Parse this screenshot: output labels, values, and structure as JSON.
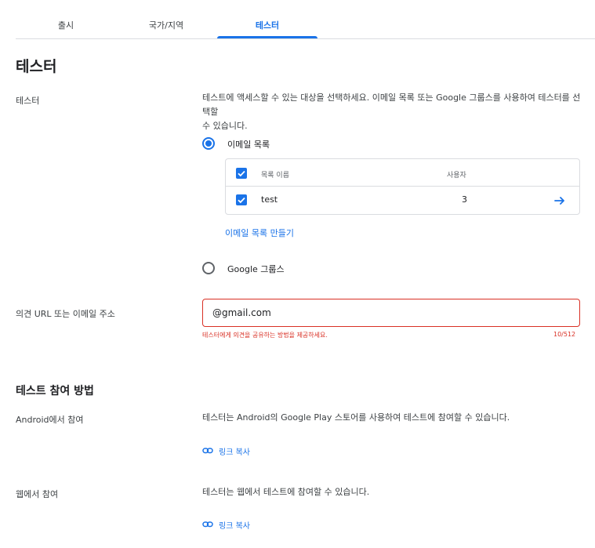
{
  "tabs": [
    {
      "label": "출시"
    },
    {
      "label": "국가/지역"
    },
    {
      "label": "테스터",
      "active": true
    }
  ],
  "page_title": "테스터",
  "testers": {
    "label": "테스터",
    "description_line1": "테스트에 액세스할 수 있는 대상을 선택하세요. 이메일 목록 또는 Google 그룹스를 사용하여 테스터를 선택할",
    "description_line2": "수 있습니다.",
    "options": [
      {
        "label": "이메일 목록",
        "selected": true
      },
      {
        "label": "Google 그룹스",
        "selected": false
      }
    ],
    "email_list_table": {
      "headers": {
        "name": "목록 이름",
        "users": "사용자"
      },
      "rows": [
        {
          "name": "test",
          "users": "3",
          "checked": true
        }
      ],
      "header_checked": true
    },
    "create_list_link": "이메일 목록 만들기"
  },
  "feedback": {
    "label": "의견 URL 또는 이메일 주소",
    "value": "@gmail.com",
    "error": "테스터에게 의견을 공유하는 방법을 제공하세요.",
    "counter": "10/512"
  },
  "how_to_join": {
    "title": "테스트 참여 방법",
    "android": {
      "label": "Android에서 참여",
      "description": "테스터는 Android의 Google Play 스토어를 사용하여 테스트에 참여할 수 있습니다.",
      "copy_link": "링크 복사"
    },
    "web": {
      "label": "웹에서 참여",
      "description": "테스터는 웹에서 테스트에 참여할 수 있습니다.",
      "copy_link": "링크 복사"
    }
  },
  "colors": {
    "accent": "#1a73e8",
    "error": "#d93025",
    "border": "#dadce0"
  },
  "icons": [
    "arrow-right-icon",
    "link-icon",
    "check-icon"
  ]
}
